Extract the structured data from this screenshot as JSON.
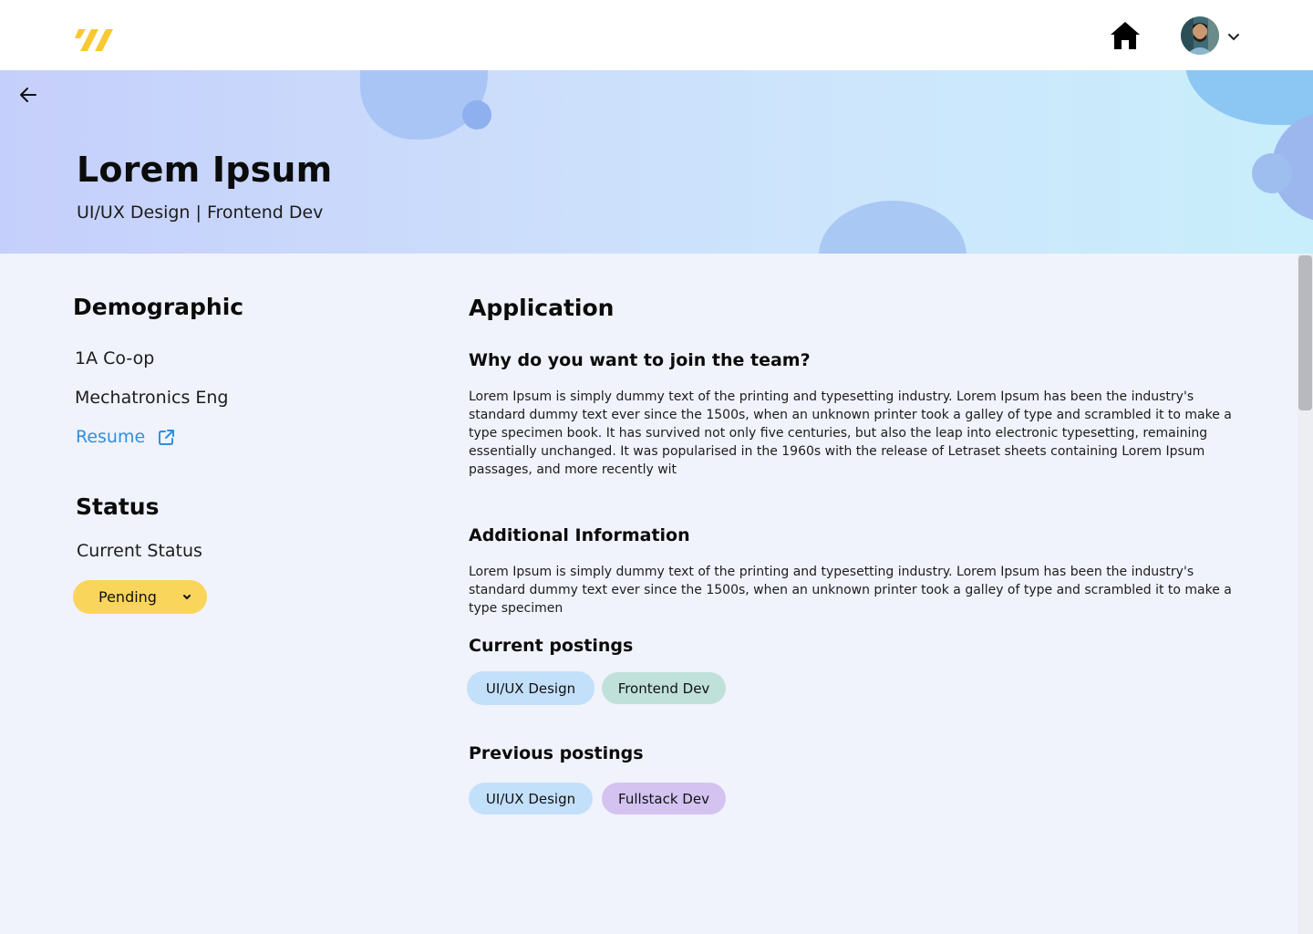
{
  "header": {
    "logo_icon": "brand-logo-icon",
    "home_icon": "home-icon",
    "avatar_icon": "user-avatar",
    "menu_icon": "chevron-down-icon",
    "brand_color": "#f9c934"
  },
  "banner": {
    "back_icon": "arrow-left-icon",
    "name": "Lorem Ipsum",
    "subtitle": "UI/UX Design | Frontend Dev"
  },
  "demographic": {
    "title": "Demographic",
    "term": "1A Co-op",
    "program": "Mechatronics Eng",
    "resume_label": "Resume",
    "resume_icon": "external-link-icon",
    "link_color": "#2f8fe0"
  },
  "status": {
    "title": "Status",
    "label": "Current Status",
    "value": "Pending",
    "color": "#fad55c"
  },
  "application": {
    "title": "Application",
    "q1": "Why do you want to join the team?",
    "a1": "Lorem Ipsum is simply dummy text of the printing and typesetting industry. Lorem Ipsum has been the industry's standard dummy text ever since the 1500s, when an unknown printer took a galley of type and scrambled it to make a type specimen book. It has survived not only five centuries, but also the leap into electronic typesetting, remaining essentially unchanged. It was popularised in the 1960s with the release of Letraset sheets containing Lorem Ipsum passages, and more recently wit",
    "q2": "Additional Information",
    "a2": "Lorem Ipsum is simply dummy text of the printing and typesetting industry. Lorem Ipsum has been the industry's standard dummy text ever since the 1500s, when an unknown printer took a galley of type and scrambled it to make a type specimen"
  },
  "current_postings": {
    "title": "Current postings",
    "items": [
      {
        "label": "UI/UX Design",
        "color": "#c3e0fb"
      },
      {
        "label": "Frontend Dev",
        "color": "#bfe1da"
      }
    ]
  },
  "previous_postings": {
    "title": "Previous postings",
    "items": [
      {
        "label": "UI/UX Design",
        "color": "#c3e0fb"
      },
      {
        "label": "Fullstack Dev",
        "color": "#d4c3f1"
      }
    ]
  }
}
